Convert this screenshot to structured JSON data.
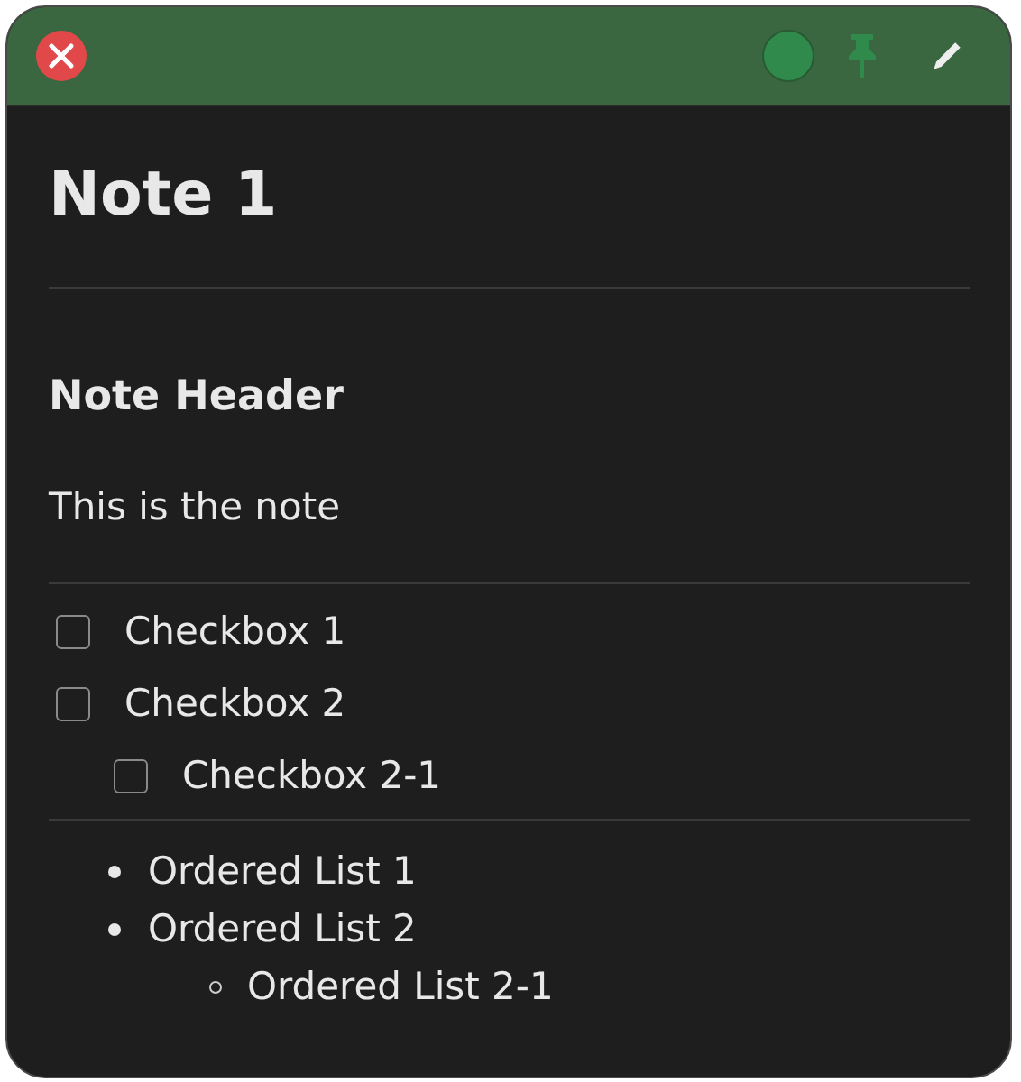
{
  "titlebar": {
    "pinned": true
  },
  "blocks": [
    {
      "kind": "heading1",
      "text": "Note 1"
    },
    {
      "kind": "divider"
    },
    {
      "kind": "heading2",
      "text": "Note Header"
    },
    {
      "kind": "paragraph",
      "text": "This is the note"
    },
    {
      "kind": "divider"
    },
    {
      "kind": "checklist",
      "items": [
        {
          "label": "Checkbox 1",
          "checked": false
        },
        {
          "label": "Checkbox 2",
          "checked": false,
          "children": [
            {
              "label": "Checkbox 2-1",
              "checked": false
            }
          ]
        }
      ]
    },
    {
      "kind": "divider"
    },
    {
      "kind": "bullets",
      "items": [
        {
          "text": "Ordered List 1"
        },
        {
          "text": "Ordered List 2",
          "children": [
            {
              "text": "Ordered List 2-1"
            }
          ]
        }
      ]
    }
  ]
}
